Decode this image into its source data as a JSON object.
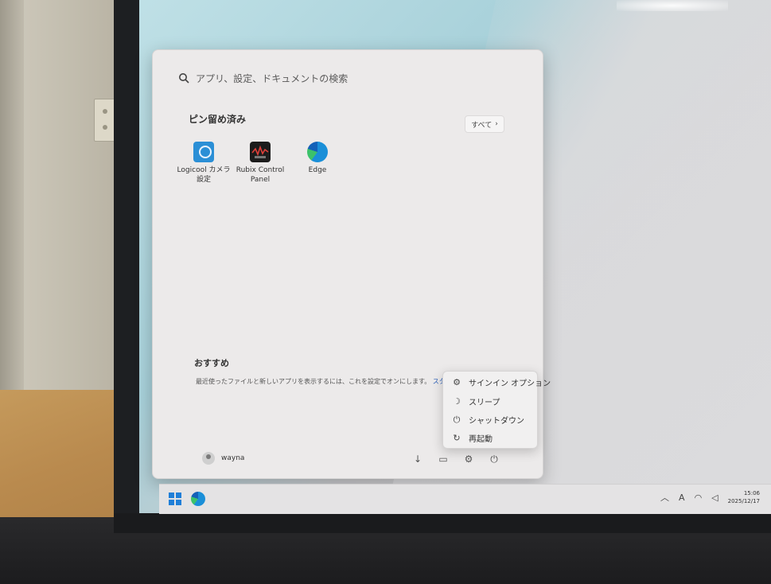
{
  "search": {
    "placeholder": "アプリ、設定、ドキュメントの検索",
    "icon": "search-icon"
  },
  "pinned": {
    "title": "ピン留め済み",
    "all_button": "すべて",
    "apps": [
      {
        "label": "Logicool カメラ設定",
        "icon": "logicool-camera-icon",
        "color": "#2b8fd6"
      },
      {
        "label": "Rubix Control Panel",
        "icon": "rubix-icon",
        "color": "#1c1c1c"
      },
      {
        "label": "Edge",
        "icon": "edge-icon",
        "color": "#1a8fd8"
      }
    ]
  },
  "recommended": {
    "title": "おすすめ",
    "text": "最近使ったファイルと新しいアプリを表示するには、これを設定でオンにします。",
    "link": "スタート設定"
  },
  "user": {
    "name": "wayna"
  },
  "footer_icons": [
    "download-icon",
    "folder-icon",
    "settings-icon",
    "power-icon"
  ],
  "power_menu": {
    "items": [
      {
        "label": "サインイン オプション",
        "icon": "gear-icon"
      },
      {
        "label": "スリープ",
        "icon": "sleep-icon"
      },
      {
        "label": "シャットダウン",
        "icon": "power-icon"
      },
      {
        "label": "再起動",
        "icon": "restart-icon"
      }
    ]
  },
  "taskbar": {
    "tray_icons": [
      "chevron-up-icon",
      "ime-icon",
      "wifi-icon",
      "volume-icon"
    ],
    "ime_label": "A",
    "time": "15:06",
    "date": "2025/12/17"
  }
}
